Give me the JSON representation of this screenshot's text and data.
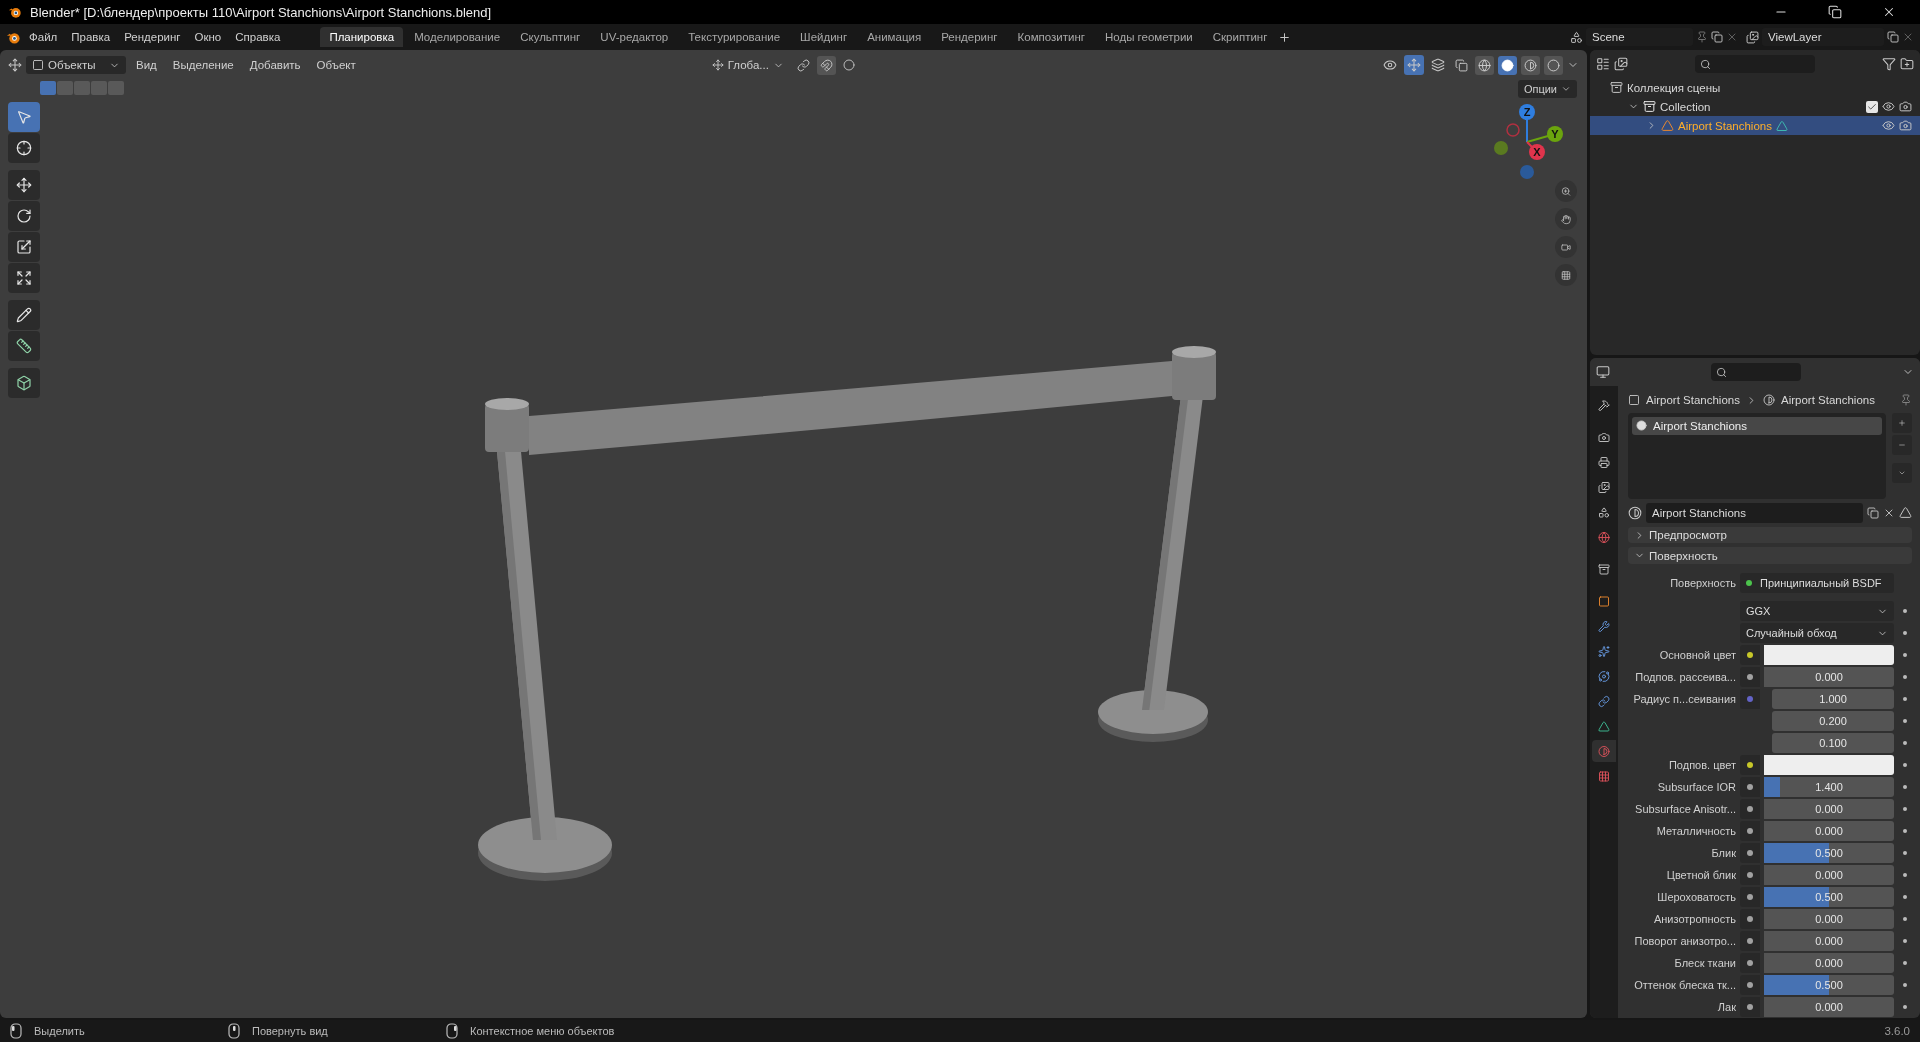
{
  "window": {
    "title": "Blender* [D:\\блендер\\проекты 110\\Airport Stanchions\\Airport Stanchions.blend]"
  },
  "menu": [
    "Файл",
    "Правка",
    "Рендеринг",
    "Окно",
    "Справка"
  ],
  "workspaces": [
    {
      "label": "Планировка",
      "selected": true
    },
    {
      "label": "Моделирование",
      "selected": false
    },
    {
      "label": "Скульптинг",
      "selected": false
    },
    {
      "label": "UV-редактор",
      "selected": false
    },
    {
      "label": "Текстурирование",
      "selected": false
    },
    {
      "label": "Шейдинг",
      "selected": false
    },
    {
      "label": "Анимация",
      "selected": false
    },
    {
      "label": "Рендеринг",
      "selected": false
    },
    {
      "label": "Композитинг",
      "selected": false
    },
    {
      "label": "Ноды геометрии",
      "selected": false
    },
    {
      "label": "Скриптинг",
      "selected": false
    }
  ],
  "scene": "Scene",
  "view_layer": "ViewLayer",
  "viewport": {
    "mode": "Объекты",
    "menus": [
      "Вид",
      "Выделение",
      "Добавить",
      "Объект"
    ],
    "orientation": "Глоба...",
    "options": "Опции",
    "gizmo_toggle": true,
    "select_modes": [
      {
        "selected": true
      },
      {
        "selected": false
      },
      {
        "selected": false
      },
      {
        "selected": false
      },
      {
        "selected": false
      }
    ],
    "shading": [
      {
        "kind": "wireframe",
        "selected": false
      },
      {
        "kind": "solid",
        "selected": true
      },
      {
        "kind": "material",
        "selected": false
      },
      {
        "kind": "rendered",
        "selected": false
      }
    ],
    "tools": [
      {
        "kind": "select",
        "selected": true
      },
      {
        "kind": "cursor",
        "selected": false
      },
      {
        "kind": "move",
        "selected": false
      },
      {
        "kind": "rotate",
        "selected": false
      },
      {
        "kind": "scale",
        "selected": false
      },
      {
        "kind": "transform",
        "selected": false
      },
      {
        "kind": "annotate",
        "selected": false
      },
      {
        "kind": "measure",
        "selected": false
      },
      {
        "kind": "add_cube",
        "selected": false
      }
    ],
    "axes": [
      {
        "label": "Z",
        "color": "#2f7ee0"
      },
      {
        "label": "Y",
        "color": "#6ba40e"
      },
      {
        "label": "X",
        "color": "#e0344c"
      }
    ]
  },
  "outliner": {
    "items": [
      {
        "kind": "scene_collection",
        "label": "Коллекция сцены",
        "children": [
          {
            "kind": "collection",
            "label": "Collection",
            "expanded": true,
            "checked": true,
            "selected": false,
            "children": [
              {
                "kind": "mesh",
                "label": "Airport Stanchions",
                "expanded": false,
                "selected": true
              }
            ]
          }
        ]
      }
    ]
  },
  "properties": {
    "tabs": [
      {
        "kind": "tool",
        "selected": false
      },
      {
        "kind": "render",
        "selected": false
      },
      {
        "kind": "output",
        "selected": false
      },
      {
        "kind": "view_layer",
        "selected": false
      },
      {
        "kind": "scene",
        "selected": false
      },
      {
        "kind": "world",
        "selected": false
      },
      {
        "kind": "collection",
        "selected": false
      },
      {
        "kind": "object",
        "selected": false
      },
      {
        "kind": "modifiers",
        "selected": false
      },
      {
        "kind": "particles",
        "selected": false
      },
      {
        "kind": "physics",
        "selected": false
      },
      {
        "kind": "constraints",
        "selected": false
      },
      {
        "kind": "data",
        "selected": false
      },
      {
        "kind": "material",
        "selected": true
      },
      {
        "kind": "texture",
        "selected": false
      }
    ],
    "breadcrumb": [
      "Airport Stanchions",
      "Airport Stanchions"
    ],
    "slots": [
      {
        "label": "Airport Stanchions",
        "selected": true
      }
    ],
    "material": "Airport Stanchions",
    "panels": [
      {
        "label": "Предпросмотр",
        "expanded": false
      },
      {
        "label": "Поверхность",
        "expanded": true,
        "rows": [
          {
            "kind": "shader",
            "label": "Поверхность",
            "value": "Принципиальный BSDF",
            "color": "#4cc34c"
          },
          {
            "kind": "dropdown",
            "value": "GGX"
          },
          {
            "kind": "dropdown",
            "value": "Случайный обход"
          },
          {
            "kind": "color",
            "label": "Основной цвет",
            "color": "#c7c729"
          },
          {
            "kind": "number",
            "label": "Подпов. рассеива...",
            "value": "0.000",
            "color": "#a1a1a1"
          },
          {
            "kind": "vector",
            "label": "Радиус п...сеивания",
            "values": [
              "1.000",
              "0.200",
              "0.100"
            ],
            "color": "#6363c7"
          },
          {
            "kind": "color",
            "label": "Подпов. цвет",
            "color": "#c7c729"
          },
          {
            "kind": "number",
            "label": "Subsurface IOR",
            "value": "1.400",
            "level": 0.12,
            "color": "#a1a1a1"
          },
          {
            "kind": "number",
            "label": "Subsurface Anisotr...",
            "value": "0.000",
            "color": "#a1a1a1"
          },
          {
            "kind": "number",
            "label": "Металличность",
            "value": "0.000",
            "color": "#a1a1a1"
          },
          {
            "kind": "number",
            "label": "Блик",
            "value": "0.500",
            "level": 0.5,
            "color": "#a1a1a1"
          },
          {
            "kind": "number",
            "label": "Цветной блик",
            "value": "0.000",
            "color": "#a1a1a1"
          },
          {
            "kind": "number",
            "label": "Шероховатость",
            "value": "0.500",
            "level": 0.5,
            "color": "#a1a1a1"
          },
          {
            "kind": "number",
            "label": "Анизотропность",
            "value": "0.000",
            "color": "#a1a1a1"
          },
          {
            "kind": "number",
            "label": "Поворот анизотро...",
            "value": "0.000",
            "color": "#a1a1a1"
          },
          {
            "kind": "number",
            "label": "Блеск ткани",
            "value": "0.000",
            "color": "#a1a1a1"
          },
          {
            "kind": "number",
            "label": "Оттенок блеска тк...",
            "value": "0.500",
            "level": 0.5,
            "color": "#a1a1a1"
          },
          {
            "kind": "number",
            "label": "Лак",
            "value": "0.000",
            "color": "#a1a1a1"
          }
        ]
      }
    ]
  },
  "status_bar": {
    "hints": [
      {
        "kind": "left",
        "label": "Выделить"
      },
      {
        "kind": "middle",
        "label": "Повернуть вид"
      },
      {
        "kind": "right",
        "label": "Контекстное меню объектов"
      }
    ],
    "version": "3.6.0"
  }
}
